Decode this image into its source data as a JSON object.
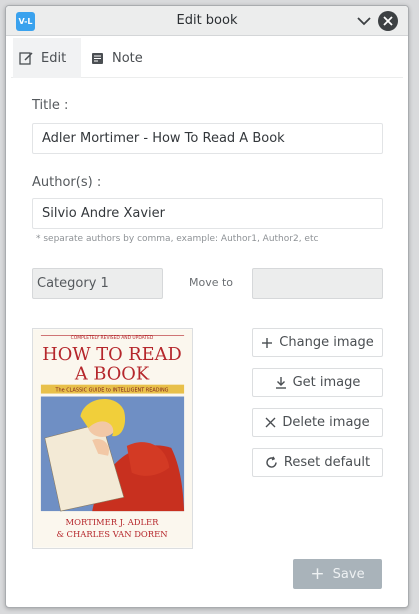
{
  "window": {
    "title": "Edit book",
    "app_icon_text": "V-L"
  },
  "tabs": [
    {
      "label": "Edit",
      "icon": "edit-icon",
      "active": true
    },
    {
      "label": "Note",
      "icon": "note-icon",
      "active": false
    }
  ],
  "form": {
    "title_label": "Title :",
    "title_value": "Adler Mortimer - How To Read A Book",
    "authors_label": "Author(s) :",
    "authors_value": "Silvio Andre Xavier",
    "authors_hint": "* separate authors by comma, example: Author1, Author2, etc",
    "category_value": "Category 1",
    "move_to_label": "Move to",
    "move_to_value": ""
  },
  "cover": {
    "top_banner": "COMPLETELY REVISED AND UPDATED",
    "line1": "HOW TO READ",
    "line1_to": "TO",
    "line2": "A BOOK",
    "subtitle": "The CLASSIC GUIDE to INTELLIGENT READING",
    "author1": "MORTIMER J. ADLER",
    "author2": "& CHARLES VAN DOREN"
  },
  "buttons": {
    "change_image": "Change image",
    "get_image": "Get image",
    "delete_image": "Delete image",
    "reset_default": "Reset default",
    "save": "Save"
  },
  "colors": {
    "accent": "#3aa2ee",
    "save_disabled": "#a9b3ba",
    "cover_red": "#b5262b"
  }
}
